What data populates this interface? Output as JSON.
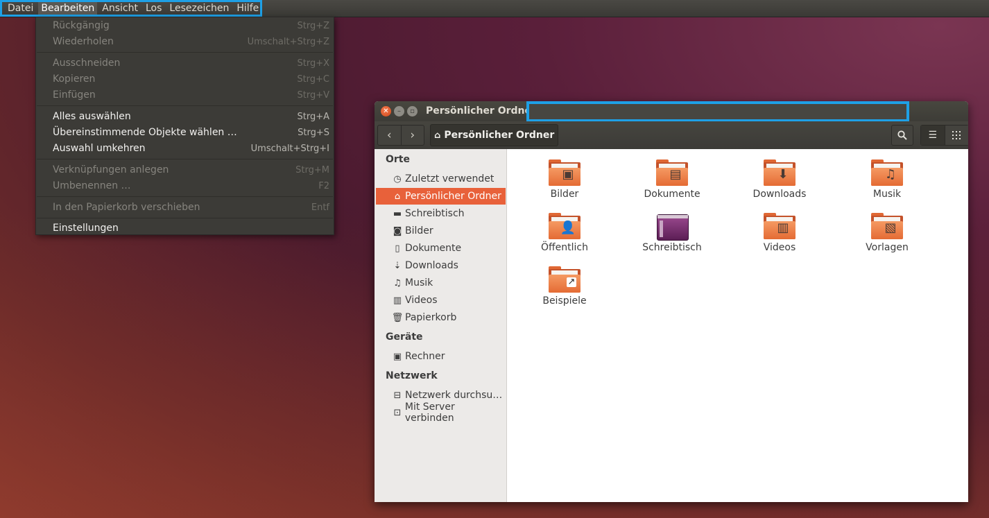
{
  "menubar": {
    "items": [
      "Datei",
      "Bearbeiten",
      "Ansicht",
      "Los",
      "Lesezeichen",
      "Hilfe"
    ]
  },
  "edit_menu": {
    "items": [
      {
        "label": "Rückgängig",
        "accel": "Strg+Z",
        "enabled": false
      },
      {
        "label": "Wiederholen",
        "accel": "Umschalt+Strg+Z",
        "enabled": false
      },
      {
        "label": "Ausschneiden",
        "accel": "Strg+X",
        "enabled": false
      },
      {
        "label": "Kopieren",
        "accel": "Strg+C",
        "enabled": false
      },
      {
        "label": "Einfügen",
        "accel": "Strg+V",
        "enabled": false
      },
      {
        "label": "Alles auswählen",
        "accel": "Strg+A",
        "enabled": true
      },
      {
        "label": "Übereinstimmende Objekte wählen …",
        "accel": "Strg+S",
        "enabled": true
      },
      {
        "label": "Auswahl umkehren",
        "accel": "Umschalt+Strg+I",
        "enabled": true
      },
      {
        "label": "Verknüpfungen anlegen",
        "accel": "Strg+M",
        "enabled": false
      },
      {
        "label": "Umbenennen …",
        "accel": "F2",
        "enabled": false
      },
      {
        "label": "In den Papierkorb verschieben",
        "accel": "Entf",
        "enabled": false
      },
      {
        "label": "Einstellungen",
        "accel": "",
        "enabled": true
      }
    ]
  },
  "window": {
    "title": "Persönlicher Ordner",
    "path_button": "Persönlicher Ordner"
  },
  "sidebar": {
    "sections": [
      {
        "heading": "Orte",
        "items": [
          {
            "label": "Zuletzt verwendet",
            "icon": "clock-icon"
          },
          {
            "label": "Persönlicher Ordner",
            "icon": "home-icon",
            "selected": true
          },
          {
            "label": "Schreibtisch",
            "icon": "folder-icon"
          },
          {
            "label": "Bilder",
            "icon": "camera-icon"
          },
          {
            "label": "Dokumente",
            "icon": "document-icon"
          },
          {
            "label": "Downloads",
            "icon": "download-icon"
          },
          {
            "label": "Musik",
            "icon": "music-icon"
          },
          {
            "label": "Videos",
            "icon": "film-icon"
          },
          {
            "label": "Papierkorb",
            "icon": "trash-icon"
          }
        ]
      },
      {
        "heading": "Geräte",
        "items": [
          {
            "label": "Rechner",
            "icon": "drive-icon"
          }
        ]
      },
      {
        "heading": "Netzwerk",
        "items": [
          {
            "label": "Netzwerk durchsu…",
            "icon": "network-icon"
          },
          {
            "label": "Mit Server verbinden",
            "icon": "server-icon"
          }
        ]
      }
    ]
  },
  "files": [
    {
      "name": "Bilder",
      "emblem": "picture-emblem-icon"
    },
    {
      "name": "Dokumente",
      "emblem": "document-emblem-icon"
    },
    {
      "name": "Downloads",
      "emblem": "download-emblem-icon"
    },
    {
      "name": "Musik",
      "emblem": "music-emblem-icon"
    },
    {
      "name": "Öffentlich",
      "emblem": "person-emblem-icon"
    },
    {
      "name": "Schreibtisch",
      "emblem": "desktop-icon"
    },
    {
      "name": "Videos",
      "emblem": "film-emblem-icon"
    },
    {
      "name": "Vorlagen",
      "emblem": "template-emblem-icon"
    },
    {
      "name": "Beispiele",
      "emblem": "link-emblem-icon"
    }
  ],
  "colors": {
    "accent": "#e8613a",
    "highlight": "#1ea0e6"
  }
}
